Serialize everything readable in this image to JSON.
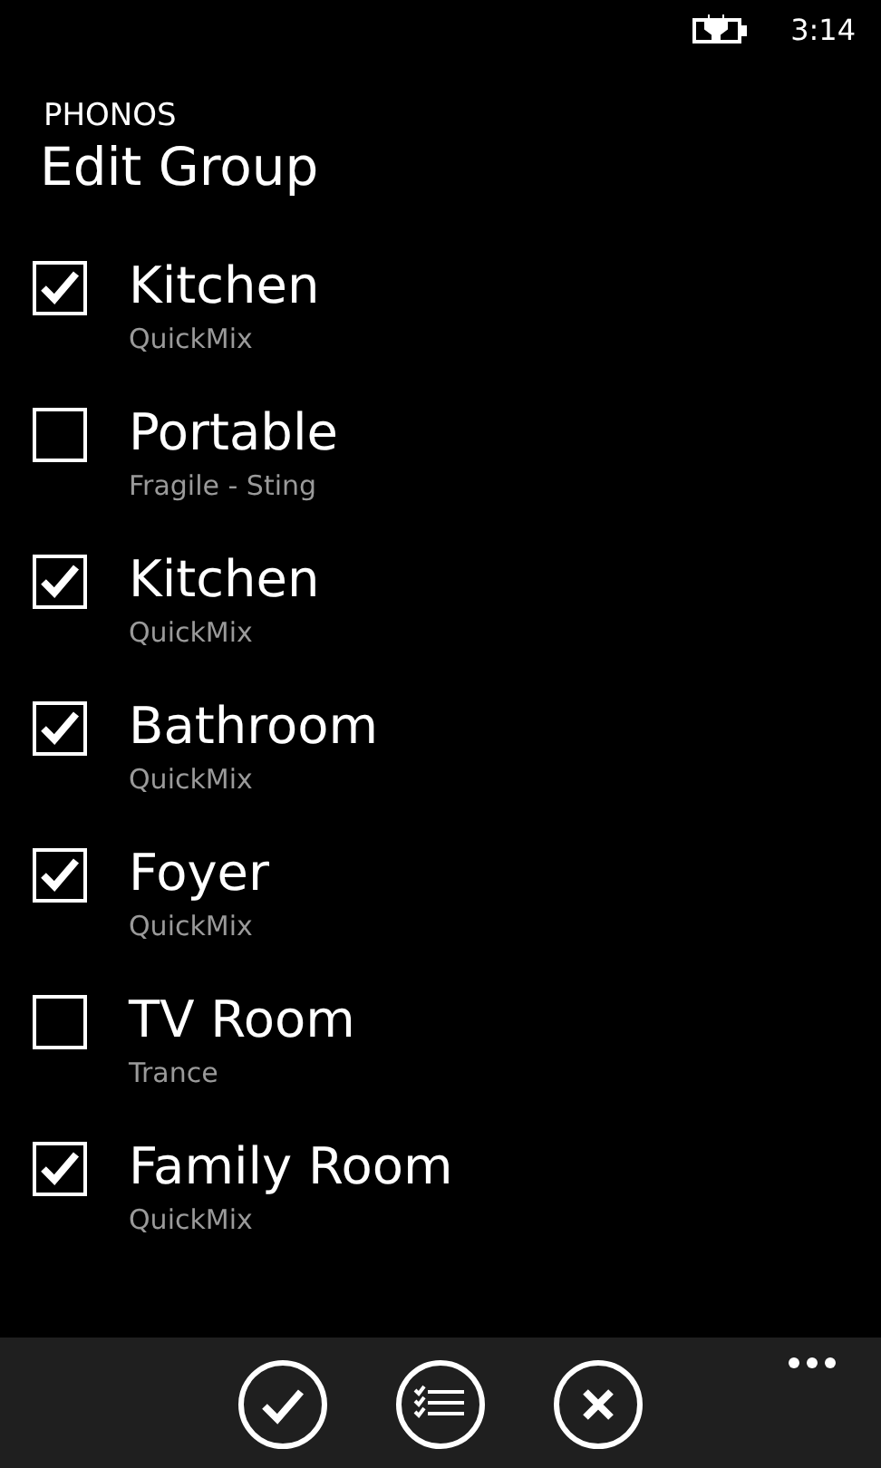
{
  "status_bar": {
    "time": "3:14"
  },
  "app_title": "PHONOS",
  "page_title": "Edit Group",
  "rooms": [
    {
      "name": "Kitchen",
      "subtitle": "QuickMix",
      "checked": true
    },
    {
      "name": "Portable",
      "subtitle": "Fragile - Sting",
      "checked": false
    },
    {
      "name": "Kitchen",
      "subtitle": "QuickMix",
      "checked": true
    },
    {
      "name": "Bathroom",
      "subtitle": "QuickMix",
      "checked": true
    },
    {
      "name": "Foyer",
      "subtitle": "QuickMix",
      "checked": true
    },
    {
      "name": "TV Room",
      "subtitle": "Trance",
      "checked": false
    },
    {
      "name": "Family Room",
      "subtitle": "QuickMix",
      "checked": true
    }
  ],
  "app_bar": {
    "buttons": [
      {
        "kind": "check"
      },
      {
        "kind": "list"
      },
      {
        "kind": "cancel"
      }
    ]
  }
}
